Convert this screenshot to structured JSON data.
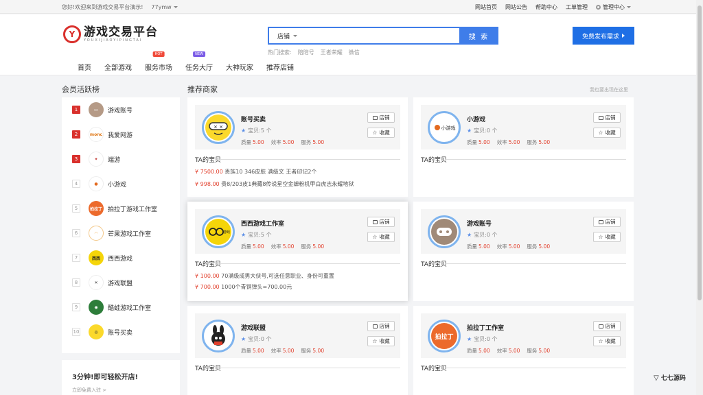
{
  "topbar": {
    "welcome": "您好!欢迎来到游戏交易平台演示!",
    "user": "77ymw",
    "links": [
      "网站首页",
      "网站公告",
      "帮助中心",
      "工单管理"
    ],
    "admin": "管理中心"
  },
  "logo": {
    "cn": "游戏交易平台",
    "en": "YOUXIJIAOYIPINGTAI"
  },
  "search": {
    "type": "店铺",
    "button": "搜 索",
    "hot_label": "热门搜索:",
    "hot": [
      "陪陪号",
      "王者荣耀",
      "微信"
    ]
  },
  "publish": "免费发布需求",
  "nav": [
    {
      "label": "首页",
      "badge": ""
    },
    {
      "label": "全部游戏",
      "badge": ""
    },
    {
      "label": "服务市场",
      "badge": "HOT"
    },
    {
      "label": "任务大厅",
      "badge": "NEW"
    },
    {
      "label": "大神玩家",
      "badge": ""
    },
    {
      "label": "推荐店铺",
      "badge": ""
    }
  ],
  "left": {
    "title": "会员活跃榜",
    "ranks": [
      {
        "n": "1",
        "name": "游戏账号"
      },
      {
        "n": "2",
        "name": "我爱网游"
      },
      {
        "n": "3",
        "name": "端游"
      },
      {
        "n": "4",
        "name": "小游戏"
      },
      {
        "n": "5",
        "name": "拍拉丁游戏工作室"
      },
      {
        "n": "6",
        "name": "芒果游戏工作室"
      },
      {
        "n": "7",
        "name": "西西游戏"
      },
      {
        "n": "8",
        "name": "游戏联盟"
      },
      {
        "n": "9",
        "name": "酷蛙游戏工作室"
      },
      {
        "n": "10",
        "name": "账号买卖"
      }
    ],
    "open_title": "3分钟!即可轻松开店!",
    "open_link": "立即免费入驻 >"
  },
  "main": {
    "title": "推荐商家",
    "more": "我也要出现在这里",
    "shop_btn": "店铺",
    "fav_btn": "收藏",
    "treasure": "TA的宝贝",
    "q_label": "质量",
    "e_label": "效率",
    "s_label": "服务",
    "cards": [
      {
        "name": "账号买卖",
        "count": "宝贝:5 个",
        "q": "5.00",
        "e": "5.00",
        "s": "5.00",
        "goods": [
          {
            "price": "¥ 7500.00",
            "desc": "贵族10 346皮肤 满级文 王者印记2个"
          },
          {
            "price": "¥ 998.00",
            "desc": "贵8/203皮1典藏8传说星空金蝉粉机甲白虎志永耀地狱"
          }
        ]
      },
      {
        "name": "小游戏",
        "count": "宝贝:0 个",
        "q": "5.00",
        "e": "5.00",
        "s": "5.00",
        "goods": []
      },
      {
        "name": "西西游戏工作室",
        "count": "宝贝:5 个",
        "q": "5.00",
        "e": "5.00",
        "s": "5.00",
        "goods": [
          {
            "price": "¥ 100.00",
            "desc": "70满级成男大侠号,可选任意职业、身份可重置"
          },
          {
            "price": "¥ 700.00",
            "desc": "1000个青铜弹头=700.00元"
          }
        ]
      },
      {
        "name": "游戏账号",
        "count": "宝贝:0 个",
        "q": "5.00",
        "e": "5.00",
        "s": "5.00",
        "goods": []
      },
      {
        "name": "游戏联盟",
        "count": "宝贝:0 个",
        "q": "5.00",
        "e": "5.00",
        "s": "5.00",
        "goods": []
      },
      {
        "name": "拍拉丁工作室",
        "count": "宝贝:0 个",
        "q": "5.00",
        "e": "5.00",
        "s": "5.00",
        "goods": []
      }
    ]
  },
  "logo_texts": {
    "xiaoyouxi": "小游戏",
    "meng": "monc",
    "xixi": "西西",
    "paladin": "拍拉丁",
    "wm": "七七源码"
  }
}
